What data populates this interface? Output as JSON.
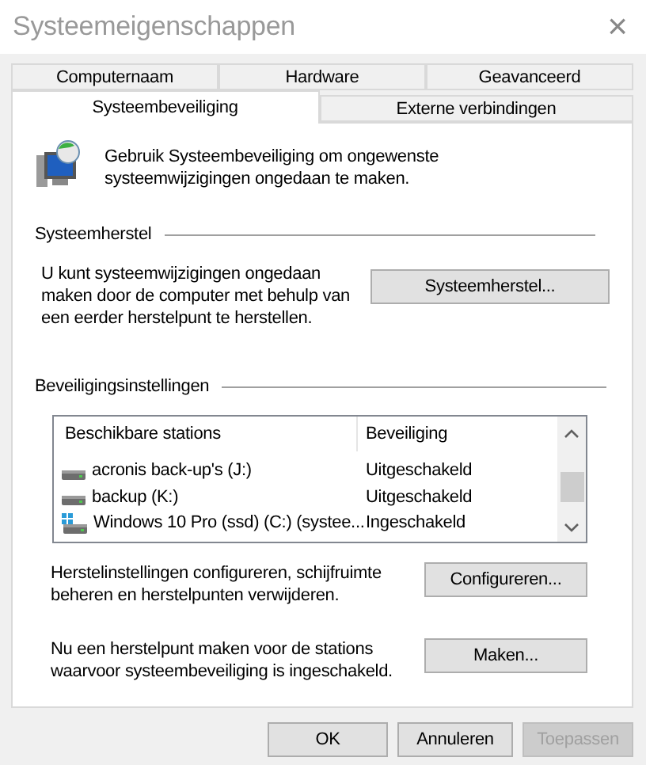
{
  "window": {
    "title": "Systeemeigenschappen",
    "close": "×"
  },
  "tab_rows": [
    [
      {
        "label": "Computernaam",
        "selected": false
      },
      {
        "label": "Hardware",
        "selected": false
      },
      {
        "label": "Geavanceerd",
        "selected": false
      }
    ],
    [
      {
        "label": "Systeembeveiliging",
        "selected": true
      },
      {
        "label": "Externe verbindingen",
        "selected": false
      }
    ]
  ],
  "intro": "Gebruik Systeembeveiliging om ongewenste systeemwijzigingen ongedaan te maken.",
  "restore_group": {
    "title": "Systeemherstel",
    "text": "U kunt systeemwijzigingen ongedaan maken door de computer met behulp van een eerder herstelpunt te herstellen.",
    "button": "Systeemherstel..."
  },
  "protection_group": {
    "title": "Beveiligingsinstellingen",
    "table": {
      "columns": [
        "Beschikbare stations",
        "Beveiliging"
      ],
      "rows": [
        {
          "kind": "drive",
          "name": "acronis back-up's (J:)",
          "protection": "Uitgeschakeld"
        },
        {
          "kind": "drive",
          "name": "backup (K:)",
          "protection": "Uitgeschakeld"
        },
        {
          "kind": "system",
          "name": "Windows 10 Pro (ssd) (C:) (systee...",
          "protection": "Ingeschakeld"
        }
      ]
    },
    "actions": [
      {
        "text": "Herstelinstellingen configureren, schijfruimte beheren en herstelpunten verwijderen.",
        "button": "Configureren..."
      },
      {
        "text": "Nu een herstelpunt maken voor de stations waarvoor systeembeveiliging is ingeschakeld.",
        "button": "Maken..."
      }
    ]
  },
  "buttons": [
    {
      "label": "OK",
      "disabled": false
    },
    {
      "label": "Annuleren",
      "disabled": false
    },
    {
      "label": "Toepassen",
      "disabled": true
    }
  ]
}
